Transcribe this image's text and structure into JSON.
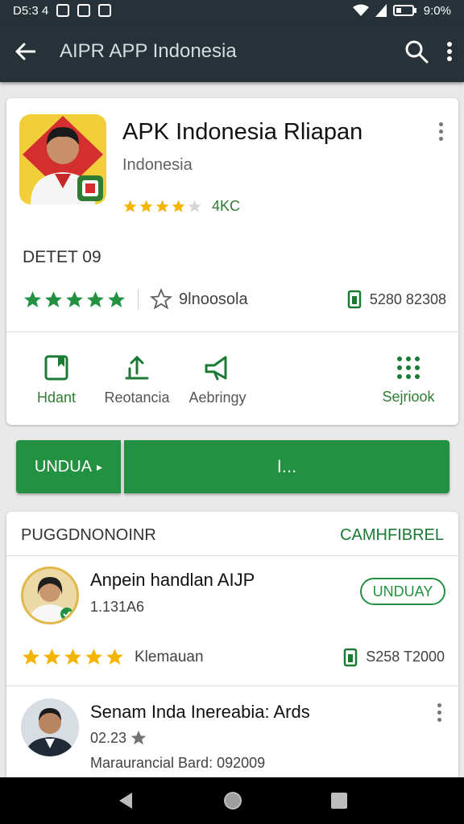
{
  "status_bar": {
    "time": "D5:3 4",
    "battery": "9:0%"
  },
  "app_bar": {
    "title": "AIPR APP Indonesia"
  },
  "app": {
    "title": "APK Indonesia Rliapan",
    "developer": "Indonesia",
    "rating_stars": 3.5,
    "rating_count": "4KC",
    "section_heading": "DETET 09",
    "stars_full": 5,
    "category": "9lnoosola",
    "size": "5280 82308"
  },
  "quick_actions": [
    {
      "label": "Hdant",
      "icon": "bookmark-icon"
    },
    {
      "label": "Reotancia",
      "icon": "share-icon"
    },
    {
      "label": "Aebringy",
      "icon": "megaphone-icon"
    },
    {
      "label": "Sejriook",
      "icon": "grid-icon"
    }
  ],
  "buttons": {
    "left": "UNDUA",
    "left_arrow": "▸",
    "main": "I..."
  },
  "recommended": {
    "heading": "PUGGDNONOINR",
    "link": "CAMHFIBREL",
    "item1": {
      "title": "Anpein handlan AIJP",
      "subtitle": "1.131A6",
      "install": "UNDUAY",
      "stars": 5,
      "label": "Klemauan",
      "size": "S258 T2000"
    },
    "item2": {
      "title": "Senam Inda Inereabia: Ards",
      "rating": "02.23",
      "meta": "Maraurancial Bard: 092009"
    }
  },
  "colors": {
    "accent": "#239142",
    "appbar": "#263238",
    "star": "#f4b400"
  }
}
